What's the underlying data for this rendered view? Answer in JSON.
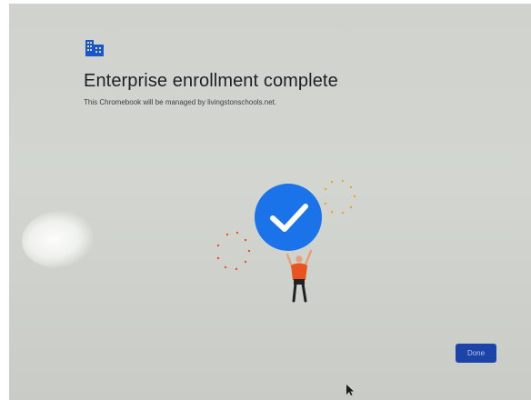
{
  "screen": {
    "title": "Enterprise enrollment complete",
    "subtitle": "This Chromebook will be managed by livingstonschools.net.",
    "done_label": "Done"
  },
  "icons": {
    "header_icon": "enterprise-building-icon",
    "hero_icon": "checkmark-icon",
    "pointer": "mouse-cursor-icon"
  },
  "colors": {
    "accent_blue": "#1a73e8",
    "button_blue": "#1c43a8",
    "figure_orange": "#e8531f"
  }
}
